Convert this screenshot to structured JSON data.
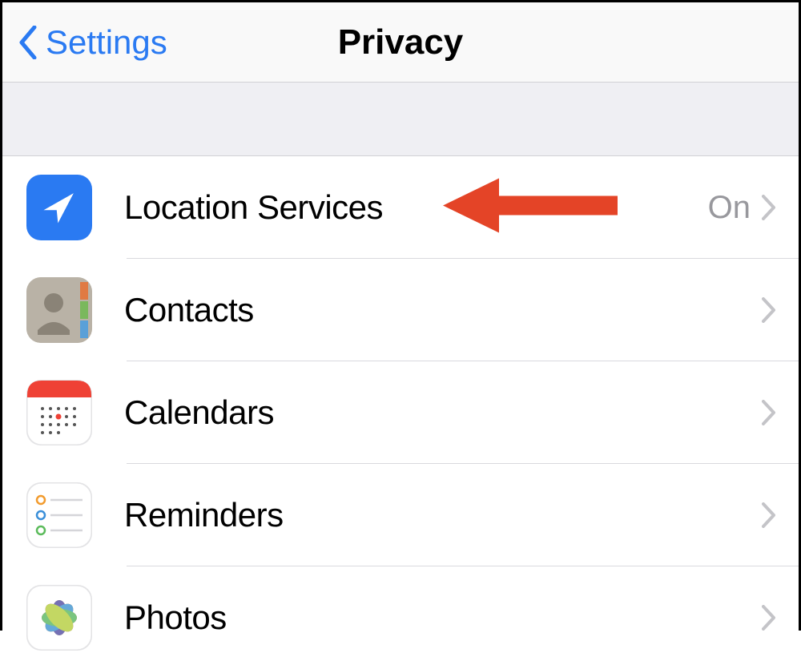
{
  "nav": {
    "back_label": "Settings",
    "title": "Privacy"
  },
  "rows": {
    "location": {
      "label": "Location Services",
      "detail": "On"
    },
    "contacts": {
      "label": "Contacts"
    },
    "calendars": {
      "label": "Calendars"
    },
    "reminders": {
      "label": "Reminders"
    },
    "photos": {
      "label": "Photos"
    }
  },
  "annotation": {
    "arrow_color": "#E44427",
    "target": "location"
  },
  "colors": {
    "tint": "#2a7af2",
    "secondary_text": "#98989d",
    "separator": "#d9d9de"
  }
}
